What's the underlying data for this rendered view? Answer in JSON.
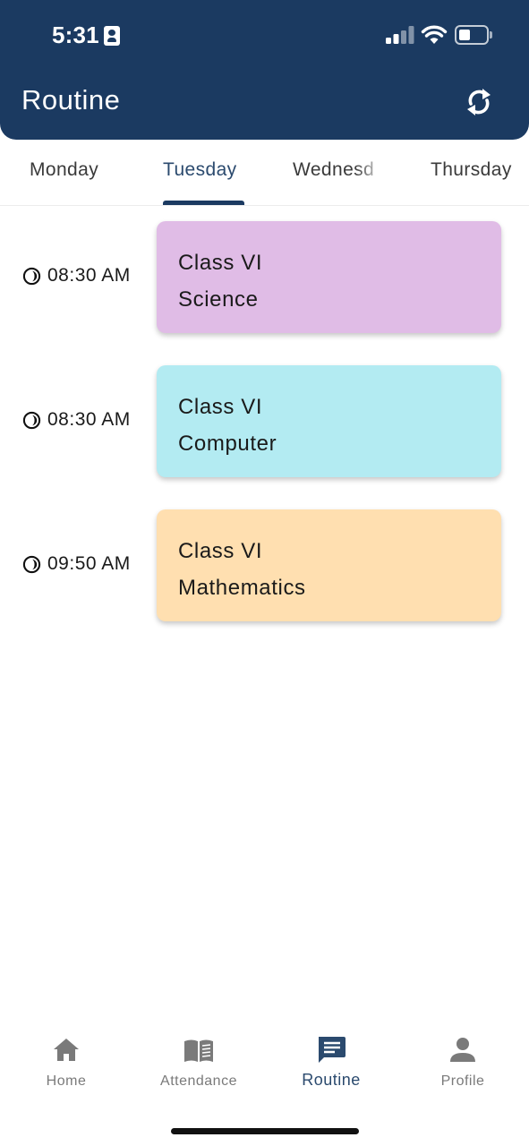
{
  "status_bar": {
    "time": "5:31"
  },
  "header": {
    "title": "Routine"
  },
  "tabs": [
    {
      "label": "Monday",
      "active": false
    },
    {
      "label": "Tuesday",
      "active": true
    },
    {
      "label": "Wednesd",
      "active": false
    },
    {
      "label": "Thursday",
      "active": false
    }
  ],
  "routine": [
    {
      "time": "08:30 AM",
      "class": "Class VI",
      "subject": "Science",
      "color": "#e0bce6"
    },
    {
      "time": "08:30 AM",
      "class": "Class VI",
      "subject": "Computer",
      "color": "#b3ebf2"
    },
    {
      "time": "09:50 AM",
      "class": "Class VI",
      "subject": "Mathematics",
      "color": "#ffdfb0"
    }
  ],
  "bottom_nav": [
    {
      "label": "Home",
      "icon": "home-icon",
      "active": false
    },
    {
      "label": "Attendance",
      "icon": "book-icon",
      "active": false
    },
    {
      "label": "Routine",
      "icon": "chat-icon",
      "active": true
    },
    {
      "label": "Profile",
      "icon": "person-icon",
      "active": false
    }
  ],
  "colors": {
    "header_bg": "#1b3a61",
    "accent": "#2b4a6e",
    "inactive_nav": "#7a7a7a"
  }
}
